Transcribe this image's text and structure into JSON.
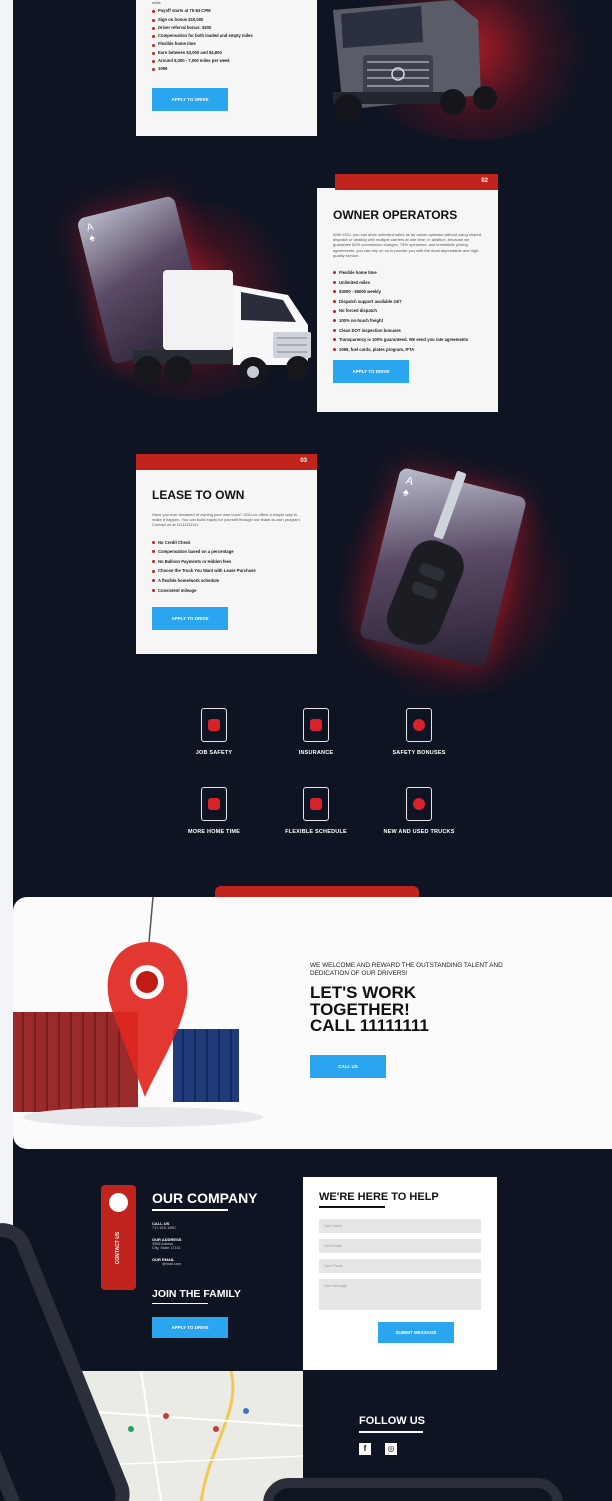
{
  "cards": {
    "company_driver": {
      "partial_text": "skills",
      "items": [
        "Payoff starts at 75-84 CPM",
        "Sign on bonus $10,000",
        "Driver referral bonus: $300",
        "Compensation for both loaded and empty miles",
        "Flexible home time",
        "Earn between $3,000 and $4,800",
        "Around 5,000 - 7,000 miles per week",
        "1099"
      ],
      "button": "APPLY TO DRIVE"
    },
    "owner_operators": {
      "number": "02",
      "title": "OWNER OPERATORS",
      "intro": "With XGU, you can drive unlimited miles as an owner operator without using shared dispatch or dealing with multiple carriers at one time. In addition, because we guarantee 80% commission charges, 75% openness, and immediate pricing agreements, you can rely on us to provide you with the most dependable and high-quality service.",
      "items": [
        "Flexible home time",
        "Unlimited miles",
        "$3000 - $6000 weekly",
        "Dispatch support available 24/7",
        "No forced dispatch",
        "100% no-touch freight",
        "Clean DOT inspection bonuses",
        "Transparency is 100% guaranteed. We send you rate agreements",
        "1099, fuel cards, plates program, IFTA"
      ],
      "button": "APPLY TO DRIVE"
    },
    "lease_to_own": {
      "number": "03",
      "title": "LEASE TO OWN",
      "intro": "Have you ever dreamed of owning your own truck? XGU.co offers a simple way to make it happen. You can build equity for yourself through our lease-to-own program. Contact us at 11111111111.",
      "items": [
        "No Credit Check",
        "Compensation based on a percentage",
        "No Balloon Payments or Hidden fees",
        "Choose the Truck You Want with Lease Purchase",
        "A flexible home/work schedule",
        "Consistent mileage"
      ],
      "button": "APPLY TO DRIVE"
    }
  },
  "features": [
    {
      "label": "JOB SAFETY",
      "icon": "shield-icon"
    },
    {
      "label": "INSURANCE",
      "icon": "box-icon"
    },
    {
      "label": "SAFETY BONUSES",
      "icon": "dollar-icon"
    },
    {
      "label": "MORE HOME TIME",
      "icon": "home-icon"
    },
    {
      "label": "FLEXIBLE SCHEDULE",
      "icon": "calendar-icon"
    },
    {
      "label": "NEW AND USED TRUCKS",
      "icon": "key-icon"
    }
  ],
  "cta": {
    "tagline": "WE WELCOME AND REWARD THE OUTSTANDING TALENT AND DEDICATION OF OUR DRIVERS!",
    "heading_line1": "LET'S WORK",
    "heading_line2": "TOGETHER!",
    "heading_line3": "CALL 11111111",
    "button": "CALL US"
  },
  "company": {
    "contact_tab": "CONTACT US",
    "title": "OUR COMPANY",
    "call_label": "CALL US",
    "call_value": "717-610-1980",
    "address_label": "OUR ADDRESS",
    "address_line1": "3966 Adress",
    "address_line2": "City, State 17101",
    "email_label": "OUR EMAIL",
    "email_value": "@mail.com",
    "join_title": "JOIN THE FAMILY",
    "join_button": "APPLY TO DRIVE"
  },
  "help_form": {
    "title": "WE'RE HERE TO HELP",
    "name_placeholder": "Your Name",
    "email_placeholder": "Your Email",
    "phone_placeholder": "Your Phone",
    "message_placeholder": "Your Message",
    "submit": "SUBMIT MESSAGE"
  },
  "follow": {
    "title": "FOLLOW US",
    "facebook": "f",
    "instagram": "◎"
  },
  "colors": {
    "brand_red": "#c0241d",
    "accent_blue": "#2aa6f0",
    "background_navy": "#0f1423"
  }
}
